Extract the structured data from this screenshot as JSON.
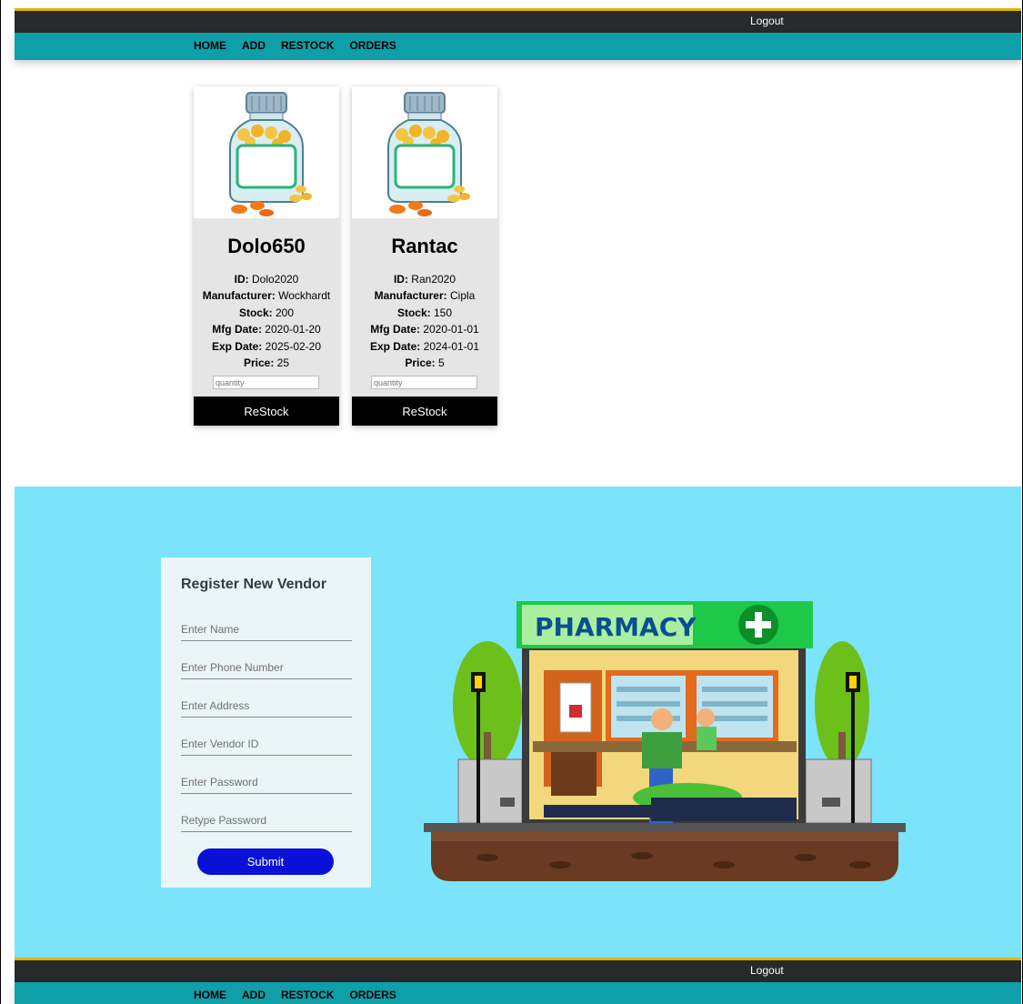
{
  "nav": {
    "logout": "Logout",
    "items": [
      "HOME",
      "ADD",
      "RESTOCK",
      "ORDERS"
    ]
  },
  "products": [
    {
      "name": "Dolo650",
      "id_label": "ID:",
      "id": " Dolo2020",
      "manufacturer_label": "Manufacturer:",
      "manufacturer": " Wockhardt",
      "stock_label": "Stock:",
      "stock": " 200",
      "mfg_label": "Mfg Date:",
      "mfg": " 2020-01-20",
      "exp_label": "Exp Date:",
      "exp": " 2025-02-20",
      "price_label": "Price:",
      "price": " 25",
      "quantity_placeholder": "quantity",
      "button": "ReStock"
    },
    {
      "name": "Rantac",
      "id_label": "ID:",
      "id": " Ran2020",
      "manufacturer_label": "Manufacturer:",
      "manufacturer": " Cipla",
      "stock_label": "Stock:",
      "stock": " 150",
      "mfg_label": "Mfg Date:",
      "mfg": " 2020-01-01",
      "exp_label": "Exp Date:",
      "exp": " 2024-01-01",
      "price_label": "Price:",
      "price": " 5",
      "quantity_placeholder": "quantity",
      "button": "ReStock"
    }
  ],
  "vendor_form": {
    "title": "Register New Vendor",
    "name_placeholder": "Enter Name",
    "phone_placeholder": "Enter Phone Number",
    "address_placeholder": "Enter Address",
    "vendor_id_placeholder": "Enter Vendor ID",
    "password_placeholder": "Enter Password",
    "retype_placeholder": "Retype Password",
    "submit": "Submit"
  },
  "illustration": {
    "sign": "PHARMACY"
  },
  "colors": {
    "topbar": "#262a2b",
    "navbar": "#0e9fa8",
    "banner": "#7be3fb",
    "submit": "#0a10d8",
    "sign_green": "#1ec94a"
  }
}
